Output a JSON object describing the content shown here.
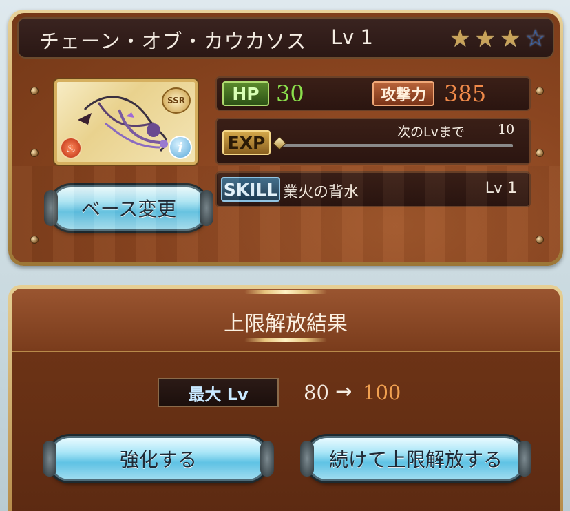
{
  "weapon": {
    "name": "チェーン・オブ・カウカソス",
    "level": "Lv 1",
    "stars_filled": 3,
    "stars_total": 4,
    "rarity": "SSR",
    "element": "fire",
    "base_change_label": "ベース変更",
    "stats": {
      "hp_label": "HP",
      "hp_value": "30",
      "atk_label": "攻撃力",
      "atk_value": "385"
    },
    "exp": {
      "label": "EXP",
      "next_label": "次のLvまで",
      "next_value": "10",
      "progress": 0
    },
    "skill": {
      "label": "SKILL",
      "name": "業火の背水",
      "level": "Lv 1"
    }
  },
  "result": {
    "title": "上限解放結果",
    "max_lv_label": "最大 Lv",
    "old_max": "80",
    "arrow": "→",
    "new_max": "100",
    "enhance_label": "強化する",
    "continue_label": "続けて上限解放する"
  },
  "colors": {
    "hp": "#8be04c",
    "atk": "#f08a4a",
    "new_max": "#f0a050"
  }
}
